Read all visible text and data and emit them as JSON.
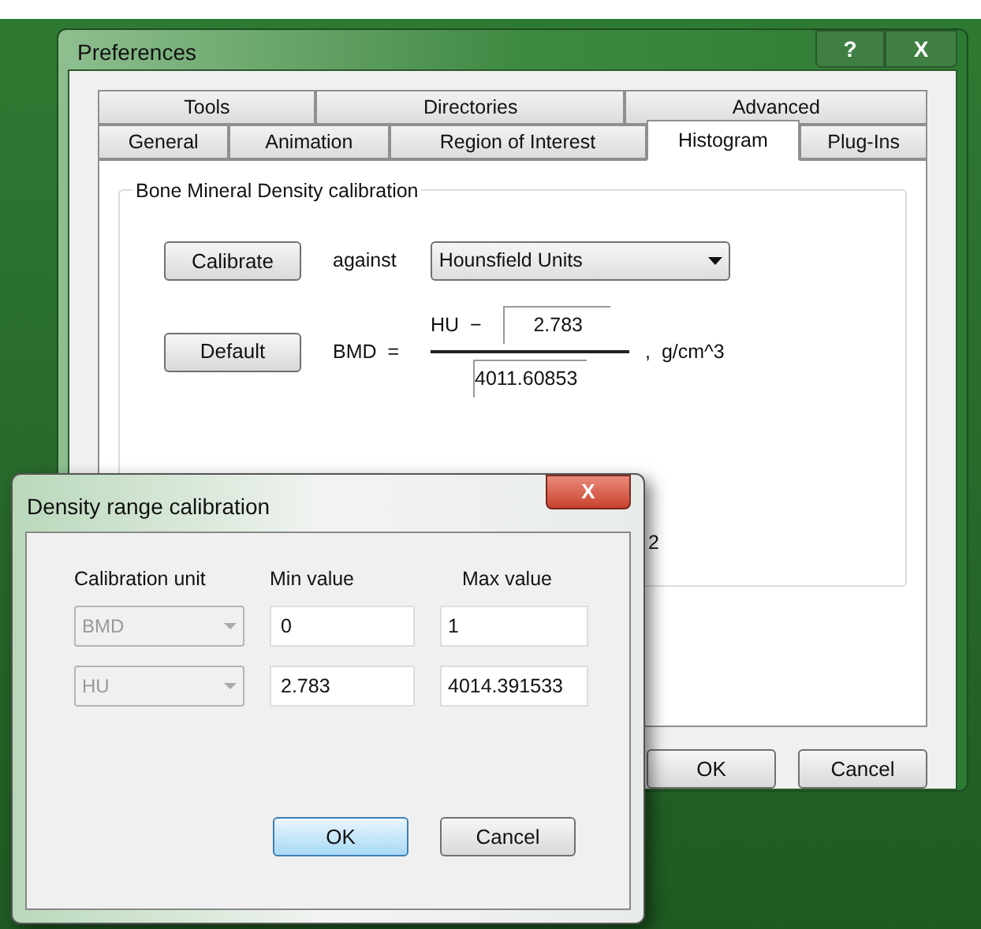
{
  "preferences": {
    "title": "Preferences",
    "help_button": "?",
    "close_button": "X",
    "tab_rows": [
      [
        {
          "label": "Tools",
          "selected": false
        },
        {
          "label": "Directories",
          "selected": false
        },
        {
          "label": "Advanced",
          "selected": false
        }
      ],
      [
        {
          "label": "General",
          "selected": false
        },
        {
          "label": "Animation",
          "selected": false
        },
        {
          "label": "Region of Interest",
          "selected": false
        },
        {
          "label": "Histogram",
          "selected": true
        },
        {
          "label": "Plug-Ins",
          "selected": false
        }
      ]
    ],
    "group": {
      "title": "Bone Mineral Density calibration",
      "calibrate_button": "Calibrate",
      "against_label": "against",
      "unit_dropdown": "Hounsfield Units",
      "default_button": "Default",
      "bmd_label": "BMD  =",
      "numerator_label": "HU  −",
      "offset_value": "2.783",
      "divisor_value": "4011.60853",
      "unit_label": ",  g/cm^3",
      "partial_text": "2"
    },
    "buttons": [
      "OK",
      "Cancel"
    ]
  },
  "dialog": {
    "title": "Density range calibration",
    "close_button": "X",
    "columns": [
      "Calibration unit",
      "Min value",
      "Max value"
    ],
    "rows": [
      {
        "unit": "BMD",
        "disabled": true,
        "min": "0",
        "max": "1"
      },
      {
        "unit": "HU",
        "disabled": true,
        "min": "2.783",
        "max": "4014.391533"
      }
    ],
    "buttons": [
      {
        "label": "OK",
        "selected": true
      },
      {
        "label": "Cancel",
        "selected": false
      }
    ]
  }
}
